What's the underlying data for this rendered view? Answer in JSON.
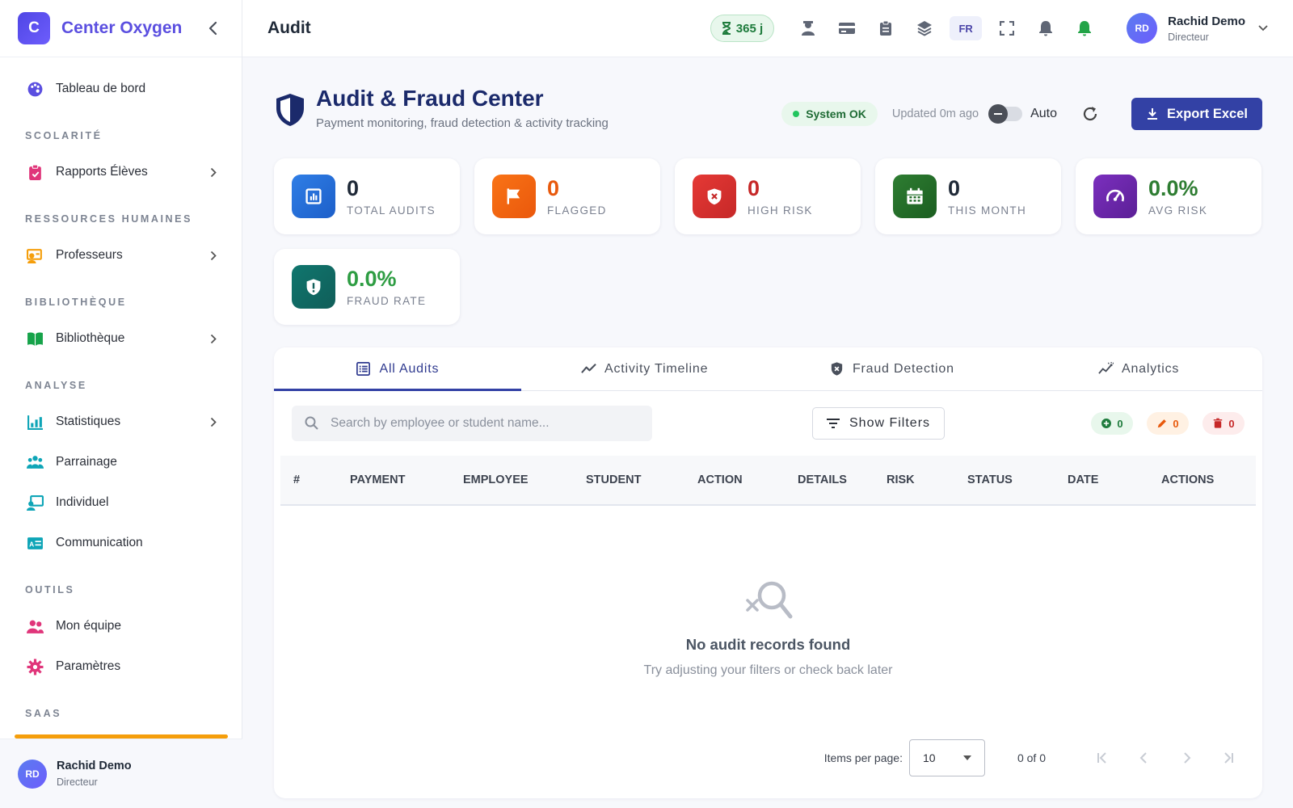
{
  "brand": {
    "logo_letter": "C",
    "name": "Center Oxygen"
  },
  "sidebar": {
    "items": [
      {
        "type": "item",
        "name": "tableau-de-bord",
        "label": "Tableau de bord",
        "icon": "palette-icon",
        "color": "#5b4fe0",
        "chevron": false
      },
      {
        "type": "section",
        "label": "SCOLARITÉ"
      },
      {
        "type": "item",
        "name": "rapports-eleves",
        "label": "Rapports Élèves",
        "icon": "clipboard-icon",
        "color": "#e0357a",
        "chevron": true
      },
      {
        "type": "section",
        "label": "RESSOURCES HUMAINES"
      },
      {
        "type": "item",
        "name": "professeurs",
        "label": "Professeurs",
        "icon": "teacher-icon",
        "color": "#f59e0b",
        "chevron": true
      },
      {
        "type": "section",
        "label": "BIBLIOTHÈQUE"
      },
      {
        "type": "item",
        "name": "bibliotheque",
        "label": "Bibliothèque",
        "icon": "book-icon",
        "color": "#16a34a",
        "chevron": true
      },
      {
        "type": "section",
        "label": "ANALYSE"
      },
      {
        "type": "item",
        "name": "statistiques",
        "label": "Statistiques",
        "icon": "chart-icon",
        "color": "#0ea5b7",
        "chevron": true
      },
      {
        "type": "item",
        "name": "parrainage",
        "label": "Parrainage",
        "icon": "people-icon",
        "color": "#0ea5b7",
        "chevron": false
      },
      {
        "type": "item",
        "name": "individuel",
        "label": "Individuel",
        "icon": "presenter-icon",
        "color": "#0ea5b7",
        "chevron": false
      },
      {
        "type": "item",
        "name": "communication",
        "label": "Communication",
        "icon": "id-card-icon",
        "color": "#0ea5b7",
        "chevron": false
      },
      {
        "type": "section",
        "label": "OUTILS"
      },
      {
        "type": "item",
        "name": "mon-equipe",
        "label": "Mon équipe",
        "icon": "team-icon",
        "color": "#e0357a",
        "chevron": false
      },
      {
        "type": "item",
        "name": "parametres",
        "label": "Paramètres",
        "icon": "gear-icon",
        "color": "#e0357a",
        "chevron": false
      },
      {
        "type": "section",
        "label": "SAAS"
      }
    ],
    "user": {
      "initials": "RD",
      "name": "Rachid Demo",
      "role": "Directeur"
    }
  },
  "header": {
    "title": "Audit",
    "days_badge": "365 j",
    "lang": "FR",
    "user": {
      "initials": "RD",
      "name": "Rachid Demo",
      "role": "Directeur"
    }
  },
  "hero": {
    "title": "Audit & Fraud Center",
    "subtitle": "Payment monitoring, fraud detection & activity tracking",
    "status": "System OK",
    "updated": "Updated 0m ago",
    "auto_label": "Auto",
    "export_label": "Export Excel"
  },
  "stats": [
    {
      "name": "total-audits",
      "value": "0",
      "label": "TOTAL AUDITS",
      "color": "#1f2937",
      "icon": "bar-chart-icon",
      "bg": "linear-gradient(135deg,#2f7ee6,#1d5fc9)"
    },
    {
      "name": "flagged",
      "value": "0",
      "label": "FLAGGED",
      "color": "#e8590c",
      "icon": "flag-icon",
      "bg": "linear-gradient(135deg,#f97316,#ea580c)"
    },
    {
      "name": "high-risk",
      "value": "0",
      "label": "HIGH RISK",
      "color": "#c62828",
      "icon": "shield-x-icon",
      "bg": "linear-gradient(135deg,#e53935,#c62828)"
    },
    {
      "name": "this-month",
      "value": "0",
      "label": "THIS MONTH",
      "color": "#1f2937",
      "icon": "calendar-icon",
      "bg": "linear-gradient(135deg,#2e7d32,#1b5e20)"
    },
    {
      "name": "avg-risk",
      "value": "0.0%",
      "label": "AVG RISK",
      "color": "#2e7d32",
      "icon": "gauge-icon",
      "bg": "linear-gradient(135deg,#7b2fbe,#5b1f96)"
    },
    {
      "name": "fraud-rate",
      "value": "0.0%",
      "label": "FRAUD RATE",
      "color": "#2e9d43",
      "icon": "shield-alert-icon",
      "bg": "linear-gradient(135deg,#0f766e,#115e59)"
    }
  ],
  "tabs": [
    {
      "name": "all-audits",
      "label": "All Audits",
      "icon": "list-icon",
      "active": true
    },
    {
      "name": "activity-timeline",
      "label": "Activity Timeline",
      "icon": "timeline-icon",
      "active": false
    },
    {
      "name": "fraud-detection",
      "label": "Fraud Detection",
      "icon": "shield-icon",
      "active": false
    },
    {
      "name": "analytics",
      "label": "Analytics",
      "icon": "analytics-icon",
      "active": false
    }
  ],
  "search": {
    "placeholder": "Search by employee or student name..."
  },
  "filters_label": "Show Filters",
  "counts": [
    {
      "name": "created-count",
      "value": "0",
      "icon": "plus-circle-icon",
      "color": "#1e7b3c",
      "bg": "#e8f7ec"
    },
    {
      "name": "edited-count",
      "value": "0",
      "icon": "pencil-icon",
      "color": "#e8590c",
      "bg": "#fff1e3"
    },
    {
      "name": "deleted-count",
      "value": "0",
      "icon": "trash-icon",
      "color": "#c62828",
      "bg": "#fdecec"
    }
  ],
  "table": {
    "columns": [
      "#",
      "PAYMENT",
      "EMPLOYEE",
      "STUDENT",
      "ACTION",
      "DETAILS",
      "RISK",
      "STATUS",
      "DATE",
      "ACTIONS"
    ],
    "empty_title": "No audit records found",
    "empty_subtitle": "Try adjusting your filters or check back later"
  },
  "paginator": {
    "label": "Items per page:",
    "per_page": "10",
    "range": "0 of 0"
  }
}
